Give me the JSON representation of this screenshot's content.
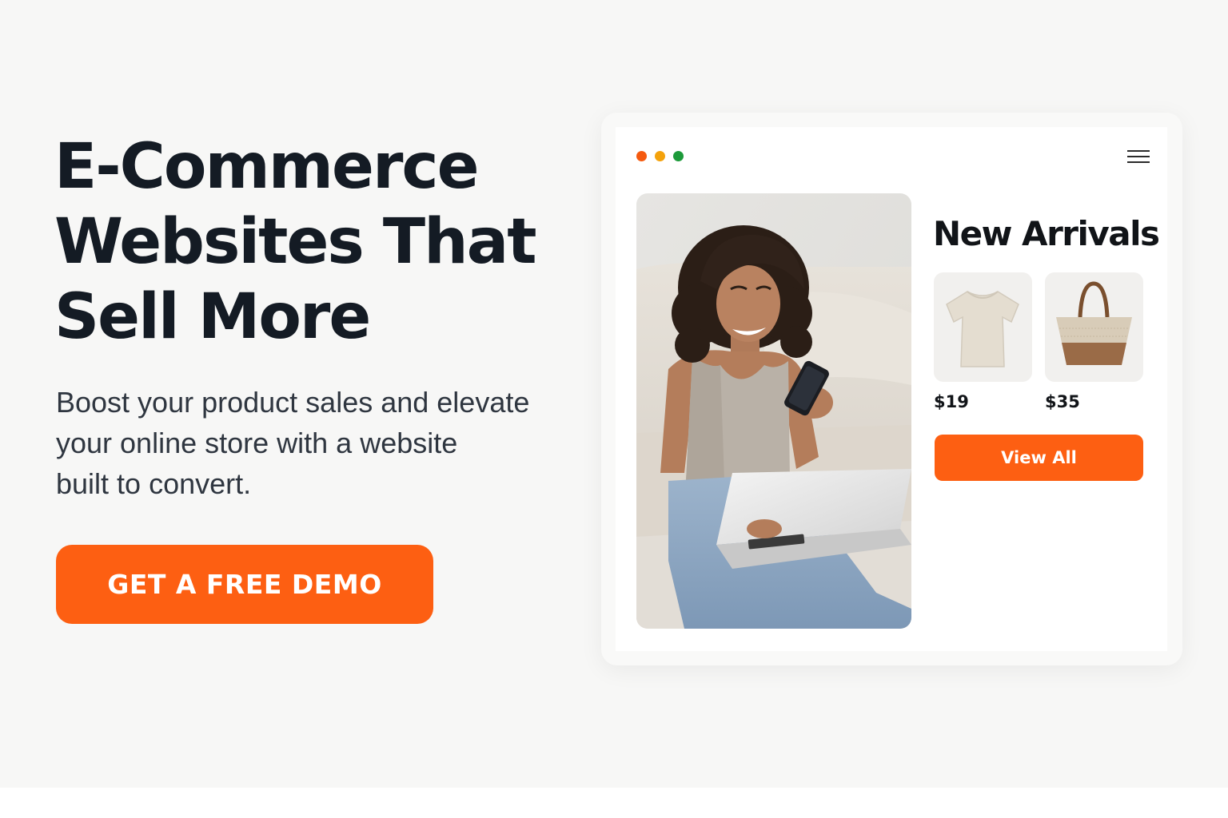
{
  "hero": {
    "headline_lines": [
      "E-Commerce",
      "Websites That",
      "Sell More"
    ],
    "subtext_lines": [
      "Boost your product sales and elevate",
      "your online store with a website",
      "built to convert."
    ],
    "cta_label": "GET A FREE DEMO"
  },
  "preview": {
    "window_dots": [
      "#f55a0f",
      "#f4a20c",
      "#1d9a3a"
    ],
    "menu_icon": "hamburger-menu-icon",
    "section_title": "New Arrivals",
    "products": [
      {
        "icon": "t-shirt-icon",
        "price": "$19"
      },
      {
        "icon": "tote-bag-icon",
        "price": "$35"
      }
    ],
    "view_all_label": "View All"
  },
  "colors": {
    "accent": "#fd5f12",
    "heading": "#141b24",
    "body_text": "#2f3640",
    "background": "#f7f7f6"
  }
}
